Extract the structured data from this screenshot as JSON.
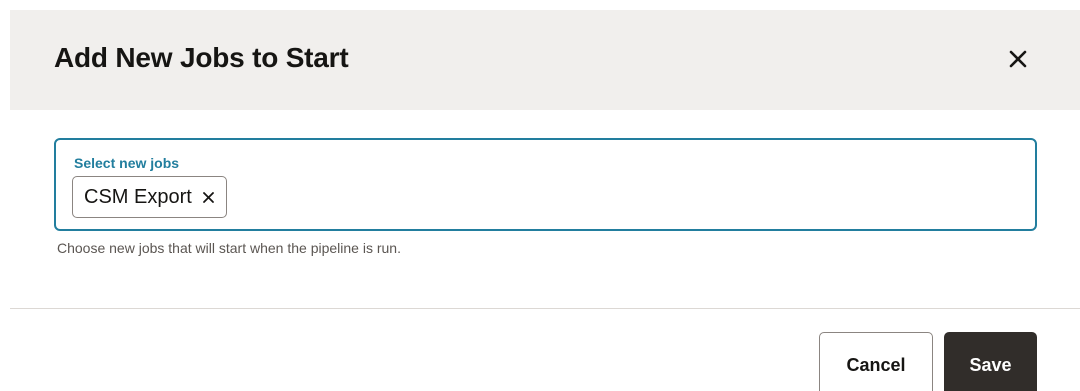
{
  "dialog": {
    "title": "Add New Jobs to Start",
    "close_icon": "close-icon"
  },
  "field": {
    "label": "Select new jobs",
    "chips": [
      {
        "label": "CSM Export",
        "remove_icon": "close-icon"
      }
    ],
    "help_text": "Choose new jobs that will start when the pipeline is run."
  },
  "footer": {
    "cancel_label": "Cancel",
    "save_label": "Save"
  },
  "colors": {
    "accent": "#227e9e",
    "header_bg": "#f1efed",
    "primary_button": "#312d2a"
  }
}
